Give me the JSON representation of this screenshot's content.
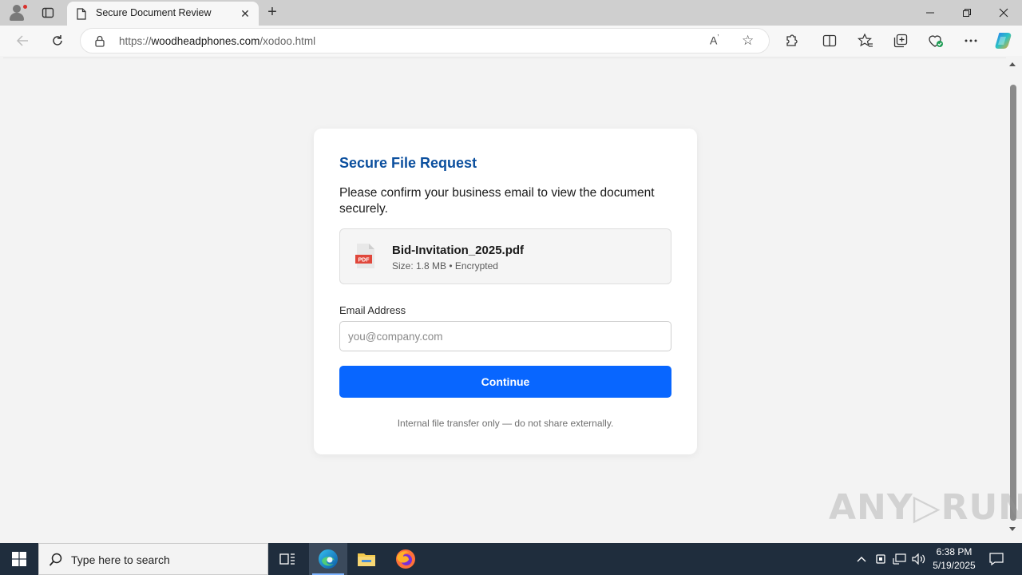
{
  "browser": {
    "tab_title": "Secure Document Review",
    "url_prefix": "https://",
    "url_host": "woodheadphones.com",
    "url_path": "/xodoo.html"
  },
  "card": {
    "title": "Secure File Request",
    "description": "Please confirm your business email to view the document securely.",
    "file": {
      "icon_label": "PDF",
      "name": "Bid-Invitation_2025.pdf",
      "meta": "Size: 1.8 MB • Encrypted"
    },
    "email_label": "Email Address",
    "email_placeholder": "you@company.com",
    "continue_label": "Continue",
    "note": "Internal file transfer only — do not share externally."
  },
  "watermark": "ANY▷RUN",
  "taskbar": {
    "search_placeholder": "Type here to search",
    "time": "6:38 PM",
    "date": "5/19/2025"
  },
  "colors": {
    "accent": "#0866ff",
    "title": "#0b4f9e",
    "pdf_red": "#e0473b"
  }
}
